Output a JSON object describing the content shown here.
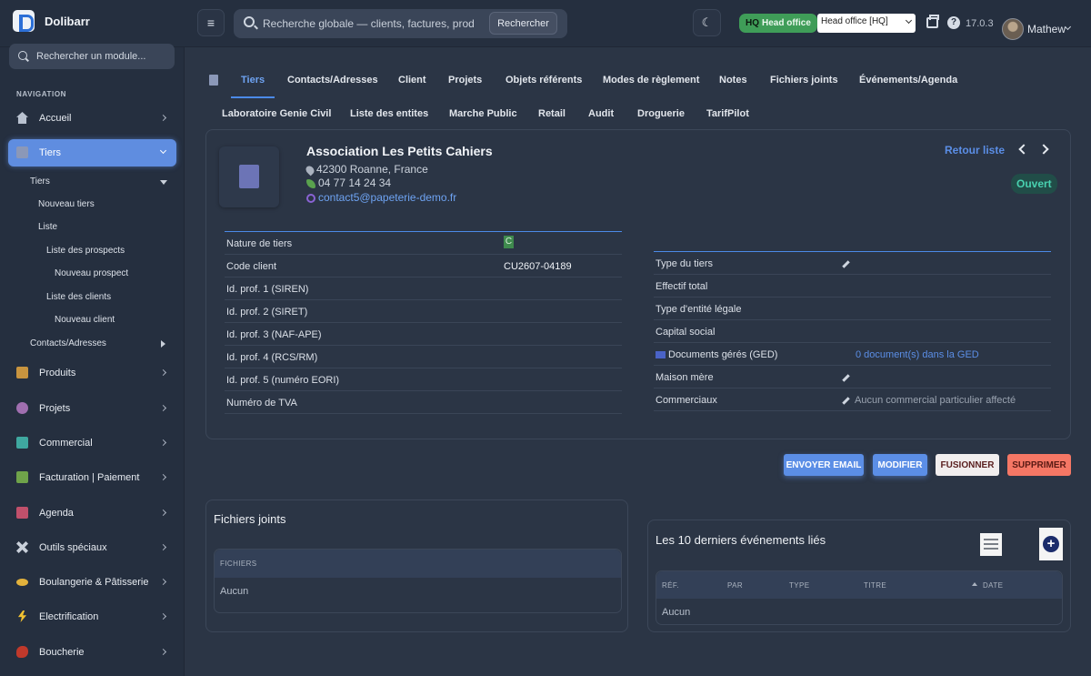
{
  "app": {
    "name": "Dolibarr"
  },
  "topbar": {
    "search_placeholder": "Recherche globale — clients, factures, produits...",
    "search_button": "Rechercher",
    "badge_hq": "HQ",
    "badge_entity": "Head office",
    "entity_select": "Head office [HQ]",
    "version": "17.0.3",
    "user": "Mathew"
  },
  "sidebar": {
    "search_placeholder": "Rechercher un module...",
    "heading": "NAVIGATION",
    "items": [
      {
        "label": "Accueil",
        "icon": "home-icon",
        "color": "#b9c2d0"
      },
      {
        "label": "Tiers",
        "icon": "building-icon",
        "color": "#8b98b8"
      },
      {
        "label": "Produits",
        "icon": "box-icon",
        "color": "#c8943f"
      },
      {
        "label": "Projets",
        "icon": "sitemap-icon",
        "color": "#a06fb0"
      },
      {
        "label": "Commercial",
        "icon": "briefcase-icon",
        "color": "#3fa8a0"
      },
      {
        "label": "Facturation | Paiement",
        "icon": "invoice-icon",
        "color": "#6fa34a"
      },
      {
        "label": "Agenda",
        "icon": "calendar-icon",
        "color": "#c0506b"
      },
      {
        "label": "Outils spéciaux",
        "icon": "tools-icon",
        "color": "#c9d0da"
      },
      {
        "label": "Boulangerie & Pâtisserie",
        "icon": "bread-icon",
        "color": "#e3b23c"
      },
      {
        "label": "Electrification",
        "icon": "bolt-icon",
        "color": "#f1c232"
      },
      {
        "label": "Boucherie",
        "icon": "meat-icon",
        "color": "#c0392b"
      }
    ],
    "sub": {
      "tiers": "Tiers",
      "nouveau_tiers": "Nouveau tiers",
      "liste": "Liste",
      "liste_prospects": "Liste des prospects",
      "nouveau_prospect": "Nouveau prospect",
      "liste_clients": "Liste des clients",
      "nouveau_client": "Nouveau client",
      "contacts": "Contacts/Adresses"
    }
  },
  "tabs_row1": [
    "Tiers",
    "Contacts/Adresses",
    "Client",
    "Projets",
    "Objets référents",
    "Modes de règlement",
    "Notes",
    "Fichiers joints",
    "Événements/Agenda"
  ],
  "tabs_row2": [
    "Laboratoire Genie Civil",
    "Liste des entites",
    "Marche Public",
    "Retail",
    "Audit",
    "Droguerie",
    "TarifPilot"
  ],
  "tiers": {
    "name": "Association Les Petits Cahiers",
    "address": "42300 Roanne, France",
    "phone": "04 77 14 24 34",
    "email": "contact5@papeterie-demo.fr",
    "retour": "Retour liste",
    "status": "Ouvert"
  },
  "left_fields": [
    {
      "label": "Nature de tiers",
      "value": "C"
    },
    {
      "label": "Code client",
      "value": "CU2607-04189"
    },
    {
      "label": "Id. prof. 1 (SIREN)",
      "value": ""
    },
    {
      "label": "Id. prof. 2 (SIRET)",
      "value": ""
    },
    {
      "label": "Id. prof. 3 (NAF-APE)",
      "value": ""
    },
    {
      "label": "Id. prof. 4 (RCS/RM)",
      "value": ""
    },
    {
      "label": "Id. prof. 5 (numéro EORI)",
      "value": ""
    },
    {
      "label": "Numéro de TVA",
      "value": ""
    }
  ],
  "right_fields": [
    {
      "label": "Type du tiers",
      "value": ""
    },
    {
      "label": "Effectif total",
      "value": ""
    },
    {
      "label": "Type d'entité légale",
      "value": ""
    },
    {
      "label": "Capital social",
      "value": ""
    },
    {
      "label": "Documents gérés (GED)",
      "value": "0 document(s) dans la GED"
    },
    {
      "label": "Maison mère",
      "value": ""
    },
    {
      "label": "Commerciaux",
      "value": "Aucun commercial particulier affecté"
    }
  ],
  "actions": {
    "email": "ENVOYER EMAIL",
    "modifier": "MODIFIER",
    "fusionner": "FUSIONNER",
    "supprimer": "SUPPRIMER"
  },
  "files": {
    "title": "Fichiers joints",
    "header": "FICHIERS",
    "empty": "Aucun"
  },
  "events": {
    "title": "Les 10 derniers événements liés",
    "columns": [
      "RÉF.",
      "PAR",
      "TYPE",
      "TITRE",
      "DATE"
    ],
    "empty": "Aucun"
  }
}
